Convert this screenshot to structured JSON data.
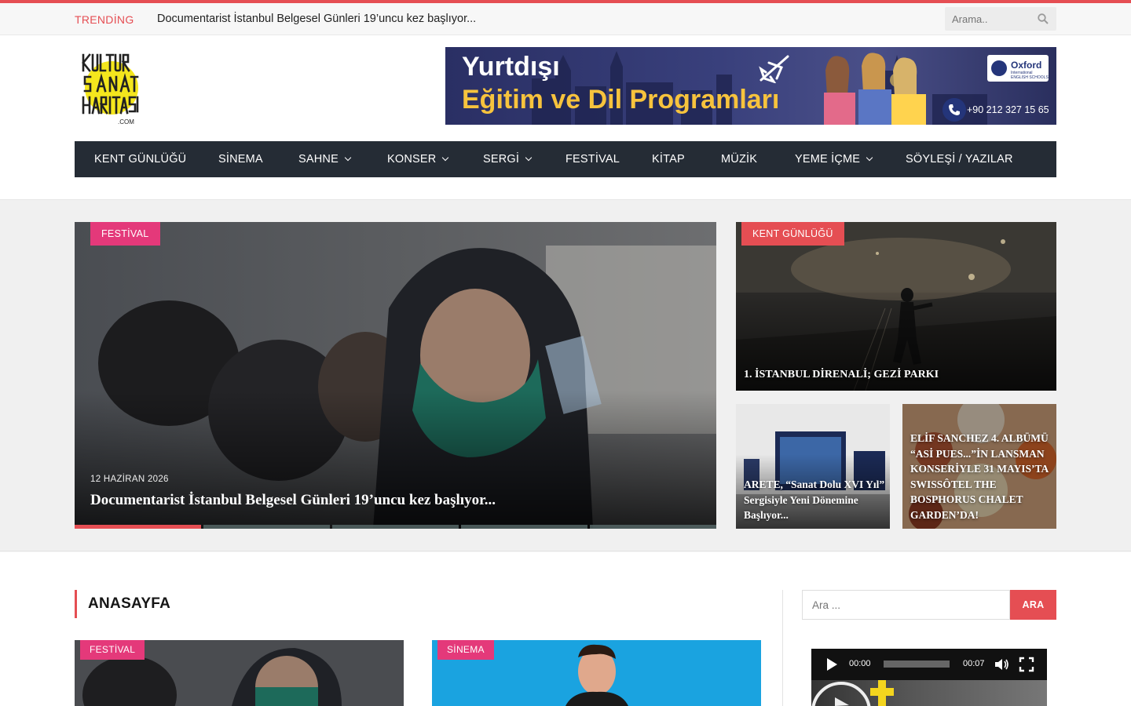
{
  "topbar": {
    "trending_label": "TRENDİNG",
    "trending_text": "Documentarist İstanbul Belgesel Günleri 19’uncu kez başlıyor...",
    "search_placeholder": "Arama.."
  },
  "banner": {
    "line1": "Yurtdışı",
    "line2": "Eğitim ve Dil Programları",
    "brand": "Oxford",
    "brand_sub": "International ENGLISH SCHOOLS",
    "phone": "+90 212 327 15 65"
  },
  "nav": {
    "items": [
      {
        "label": "KENT GÜNLÜĞÜ",
        "dropdown": false
      },
      {
        "label": "SİNEMA",
        "dropdown": false
      },
      {
        "label": "SAHNE",
        "dropdown": true
      },
      {
        "label": "KONSER",
        "dropdown": true
      },
      {
        "label": "SERGİ",
        "dropdown": true
      },
      {
        "label": "FESTİVAL",
        "dropdown": false
      },
      {
        "label": "KİTAP",
        "dropdown": false
      },
      {
        "label": "MÜZİK",
        "dropdown": false
      },
      {
        "label": "YEME İÇME",
        "dropdown": true
      },
      {
        "label": "SÖYLEŞİ / YAZILAR",
        "dropdown": false
      }
    ]
  },
  "featured": {
    "main": {
      "category": "FESTİVAL",
      "date": "12 HAZİRAN 2026",
      "title": "Documentarist İstanbul Belgesel Günleri 19’uncu kez başlıyor..."
    },
    "side_big": {
      "category": "KENT GÜNLÜĞÜ",
      "title": "1. İSTANBUL DİRENALİ; GEZİ PARKI"
    },
    "side_small": [
      {
        "title": "ARETE, “Sanat Dolu XVI Yıl” Sergisiyle Yeni Dönemine Başlıyor..."
      },
      {
        "title": "ELİF SANCHEZ 4. ALBÜMÜ “ASİ PUES...”İN LANSMAN KONSERİYLE 31 MAYIS’TA SWISSÔTEL THE BOSPHORUS CHALET GARDEN’DA!"
      }
    ],
    "slider_active_fraction": 0.2
  },
  "main": {
    "section_title": "ANASAYFA",
    "cards": [
      {
        "category": "FESTİVAL"
      },
      {
        "category": "SİNEMA"
      }
    ]
  },
  "sidebar": {
    "search_placeholder": "Ara ...",
    "search_button": "ARA",
    "video": {
      "current_time": "00:00",
      "duration": "00:07"
    }
  },
  "colors": {
    "accent": "#e54e53",
    "category_pink": "#e4397a",
    "nav_bg": "#252c35"
  }
}
